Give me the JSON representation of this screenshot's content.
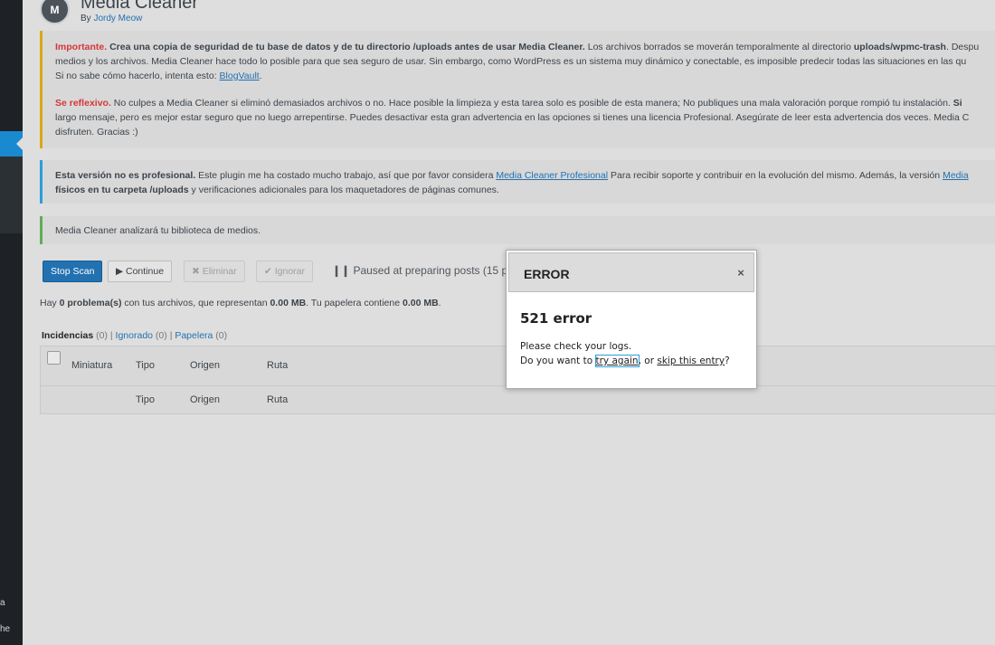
{
  "header": {
    "logo_letter": "M",
    "title": "Media Cleaner",
    "by_prefix": "By ",
    "author": "Jordy Meow"
  },
  "sidebar": {
    "bottom_texts": [
      "a",
      "he"
    ]
  },
  "notices": {
    "important": {
      "label": "Importante.",
      "bold_text": " Crea una copia de seguridad de tu base de datos y de tu directorio /uploads antes de usar Media Cleaner.",
      "text_after": " Los archivos borrados se moverán temporalmente al directorio ",
      "trash_dir": "uploads/wpmc-trash",
      "text_end": ". Despu",
      "line2": "medios y los archivos. Media Cleaner hace todo lo posible para que sea seguro de usar. Sin embargo, como WordPress es un sistema muy dinámico y conectable, es imposible predecir todas las situaciones en las qu",
      "line3_prefix": "Si no sabe cómo hacerlo, intenta esto: ",
      "blogvault_link": "BlogVault",
      "line3_suffix": "."
    },
    "reflexive": {
      "label": "Se reflexivo.",
      "line1": " No culpes a Media Cleaner si eliminó demasiados archivos o no. Hace posible la limpieza y esta tarea solo es posible de esta manera; No publiques una mala valoración porque rompió tu instalación.",
      "line1_bold": " Si",
      "line2": "largo mensaje, pero es mejor estar seguro que no luego arrepentirse. Puedes desactivar esta gran advertencia en las opciones si tienes una licencia Profesional. Asegúrate de leer esta advertencia dos veces. Media C",
      "line3": "disfruten. Gracias :)"
    },
    "pro": {
      "bold": "Esta versión no es profesional.",
      "text": " Este plugin me ha costado mucho trabajo, así que por favor considera ",
      "pro_link": "Media Cleaner Profesional",
      "text2": " Para recibir soporte y contribuir en la evolución del mismo. Además, la versión ",
      "pro_link2": "Media",
      "line2_bold": "físicos en tu carpeta /uploads",
      "line2_rest": " y verificaciones adicionales para los maquetadores de páginas comunes."
    },
    "analyze": "Media Cleaner analizará tu biblioteca de medios."
  },
  "toolbar": {
    "stop_scan": "Stop Scan",
    "continue": "Continue",
    "delete": "Eliminar",
    "ignore": "Ignorar",
    "status": "Paused at preparing posts (15 p"
  },
  "summary": {
    "prefix": "Hay ",
    "problems": "0 problema(s)",
    "middle": " con tus archivos, que representan ",
    "size1": "0.00 MB",
    "middle2": ". Tu papelera contiene ",
    "size2": "0.00 MB",
    "suffix": "."
  },
  "filters": {
    "issues": "Incidencias",
    "issues_count": "(0)",
    "ignored": "Ignorado",
    "ignored_count": "(0)",
    "trash": "Papelera",
    "trash_count": "(0)",
    "sep": "|"
  },
  "table": {
    "columns": [
      "Miniatura",
      "Tipo",
      "Origen",
      "Ruta"
    ],
    "footer_columns": [
      "Tipo",
      "Origen",
      "Ruta"
    ]
  },
  "dialog": {
    "title": "ERROR",
    "close": "×",
    "message_title": "521 error",
    "line1": "Please check your logs.",
    "line2_prefix": "Do you want to ",
    "try_again": "try again",
    "line2_mid": ", or ",
    "skip": "skip this entry",
    "line2_suffix": "?"
  }
}
